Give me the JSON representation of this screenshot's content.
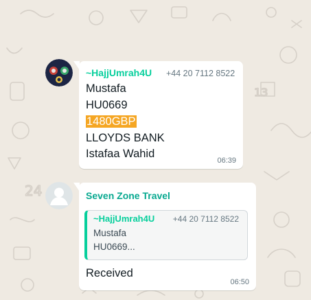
{
  "colors": {
    "background": "#efeae2",
    "sender_green": "#06cf9c",
    "highlight_orange": "#f5a623",
    "meta_gray": "#667781"
  },
  "messages": [
    {
      "sender": "~HajjUmrah4U",
      "phone": "+44 20 7112 8522",
      "avatar": "group-photo",
      "lines": [
        "Mustafa",
        "HU0669",
        "1480GBP",
        "LLOYDS BANK",
        "Istafaa Wahid"
      ],
      "highlighted": "1480GBP",
      "time": "06:39"
    },
    {
      "sender": "Seven Zone Travel",
      "avatar": "default-person-avatar",
      "quote": {
        "sender": "~HajjUmrah4U",
        "phone": "+44 20 7112 8522",
        "lines": [
          "Mustafa",
          "HU0669..."
        ]
      },
      "text": "Received",
      "time": "06:50"
    }
  ]
}
